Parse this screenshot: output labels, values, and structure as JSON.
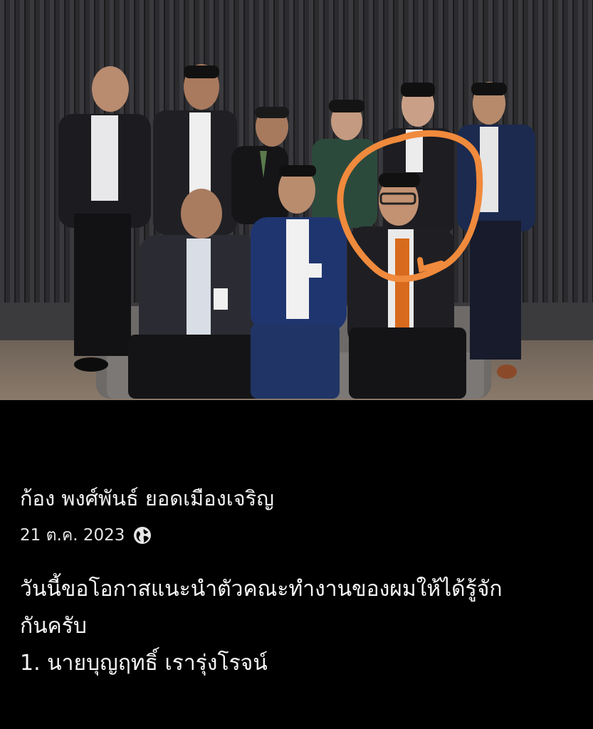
{
  "post": {
    "author_name": "ก้อง พงศ์พันธ์ ยอดเมืองเจริญ",
    "date": "21 ต.ค. 2023",
    "privacy_icon": "globe-icon",
    "text_lines": [
      "วันนี้ขอโอกาสแนะนำตัวคณะทำงานของผมให้ได้รู้จัก",
      "กันครับ",
      "1. นายบุญฤทธิ์  เรารุ่งโรจน์"
    ]
  },
  "photo": {
    "description_icon": "group-photo-image",
    "highlight_color": "#f08a3c"
  },
  "colors": {
    "background": "#000000",
    "text": "#ffffff",
    "accent_highlight": "#f08a3c"
  }
}
